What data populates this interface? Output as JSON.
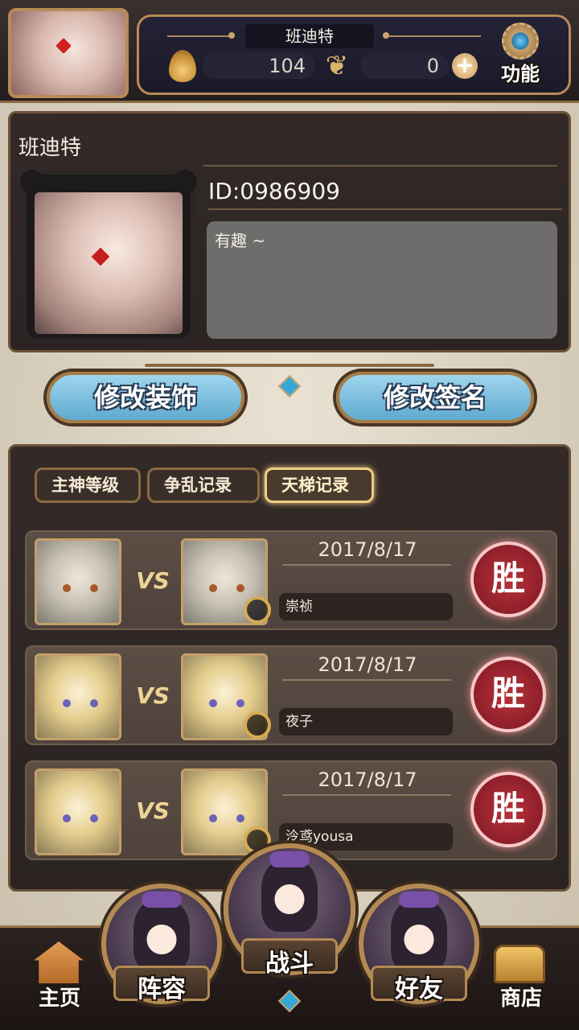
{
  "header": {
    "player_name": "班迪特",
    "currency_a": "104",
    "currency_b": "0",
    "function_label": "功能"
  },
  "profile": {
    "name": "班迪特",
    "id_text": "ID:0986909",
    "signature": "有趣 ~"
  },
  "actions": {
    "edit_decoration": "修改装饰",
    "edit_signature": "修改签名"
  },
  "tabs": [
    {
      "label": "主神等级",
      "active": false
    },
    {
      "label": "争乱记录",
      "active": false
    },
    {
      "label": "天梯记录",
      "active": true
    }
  ],
  "matches": [
    {
      "vs": "VS",
      "date": "2017/8/17",
      "opponent": "崇祯",
      "result": "胜"
    },
    {
      "vs": "VS",
      "date": "2017/8/17",
      "opponent": "夜子",
      "result": "胜"
    },
    {
      "vs": "VS",
      "date": "2017/8/17",
      "opponent": "泠鸢yousa",
      "result": "胜"
    }
  ],
  "nav": {
    "home": "主页",
    "team": "阵容",
    "battle": "战斗",
    "friends": "好友",
    "shop": "商店"
  },
  "colors": {
    "accent_gold": "#b88a55",
    "button_blue": "#7fc1e0",
    "win_red": "#a62a33",
    "panel_dark": "#2f2726"
  }
}
